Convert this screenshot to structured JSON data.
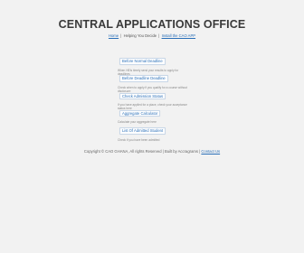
{
  "header": {
    "title": "CENTRAL APPLICATIONS OFFICE"
  },
  "topnav": {
    "home": "Home",
    "tagline": "Helping You Decide",
    "install": "Install the CAO APP",
    "sep": "|"
  },
  "items": [
    {
      "label": "Before Normal Deadline",
      "desc": "When HEIs timely send your results to apply for deadlines"
    },
    {
      "label": "Before Deadline Deadline",
      "desc": "Check when to apply if you qualify for a course without disclosure"
    },
    {
      "label": "Check Admission Status",
      "desc": "If you have applied for a place, check your acceptance status here"
    },
    {
      "label": "Aggregate Calculator",
      "desc": "Calculate your aggregate here"
    },
    {
      "label": "List Of Admitted Student",
      "desc": "Check if you have been admitted"
    }
  ],
  "footer": {
    "copyright": "Copyright © CAO GHANA, All rights Reserved | Built by Accragrams |",
    "contact": "Contact Us"
  }
}
